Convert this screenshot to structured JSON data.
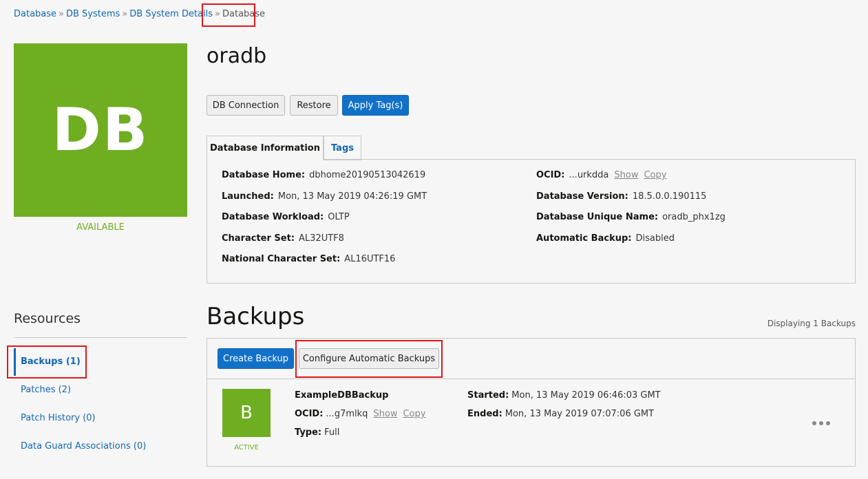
{
  "breadcrumb": {
    "items": [
      "Database",
      "DB Systems",
      "DB System Details"
    ],
    "separator": "»",
    "current": "Database"
  },
  "tile": {
    "text": "DB",
    "status": "AVAILABLE",
    "color": "#6fad21"
  },
  "title": "oradb",
  "actions": {
    "db_connection": "DB Connection",
    "restore": "Restore",
    "apply_tags": "Apply Tag(s)"
  },
  "tabs": [
    {
      "label": "Database Information",
      "active": true
    },
    {
      "label": "Tags",
      "active": false
    }
  ],
  "info": {
    "left": [
      {
        "label": "Database Home:",
        "value": "dbhome20190513042619"
      },
      {
        "label": "Launched:",
        "value": "Mon, 13 May 2019 04:26:19 GMT"
      },
      {
        "label": "Database Workload:",
        "value": "OLTP"
      },
      {
        "label": "Character Set:",
        "value": "AL32UTF8"
      },
      {
        "label": "National Character Set:",
        "value": "AL16UTF16"
      }
    ],
    "right": [
      {
        "label": "OCID:",
        "value": "...urkdda",
        "show": "Show",
        "copy": "Copy"
      },
      {
        "label": "Database Version:",
        "value": "18.5.0.0.190115"
      },
      {
        "label": "Database Unique Name:",
        "value": "oradb_phx1zg"
      },
      {
        "label": "Automatic Backup:",
        "value": "Disabled"
      }
    ]
  },
  "resources": {
    "title": "Resources",
    "items": [
      {
        "label": "Backups (1)",
        "active": true
      },
      {
        "label": "Patches (2)"
      },
      {
        "label": "Patch History (0)"
      },
      {
        "label": "Data Guard Associations (0)"
      }
    ]
  },
  "backups": {
    "title": "Backups",
    "displaying": "Displaying 1 Backups",
    "create_label": "Create Backup",
    "configure_label": "Configure Automatic Backups",
    "item": {
      "tile_text": "B",
      "status": "ACTIVE",
      "name": "ExampleDBBackup",
      "ocid_label": "OCID:",
      "ocid_value": "...g7mlkq",
      "show": "Show",
      "copy": "Copy",
      "type_label": "Type:",
      "type_value": "Full",
      "started_label": "Started:",
      "started_value": "Mon, 13 May 2019 06:46:03 GMT",
      "ended_label": "Ended:",
      "ended_value": "Mon, 13 May 2019 07:07:06 GMT"
    }
  },
  "colors": {
    "accent": "#1171c9",
    "link": "#1167b1",
    "success": "#6fad21",
    "highlight": "#e0161c"
  }
}
